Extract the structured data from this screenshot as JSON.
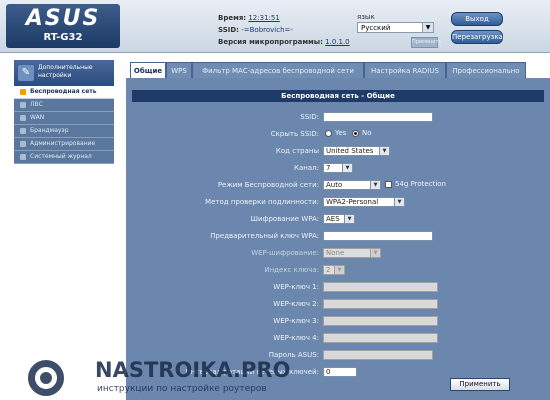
{
  "header": {
    "brand": "ASUS",
    "model": "RT-G32",
    "time_label": "Время:",
    "time_value": "12:31:51",
    "ssid_label": "SSID:",
    "ssid_value": "-=Bobrovich=-",
    "firmware_label": "Версия микропрограммы:",
    "firmware_value": "1.0.1.0",
    "lang_label": "язык",
    "lang_value": "Русский",
    "lang_apply": "Применить",
    "logout": "Выход",
    "reboot": "Перезагрузка"
  },
  "sidebar": {
    "heading": "Дополнительные настройки",
    "items": [
      {
        "label": "Беспроводная сеть",
        "active": true
      },
      {
        "label": "ЛВС",
        "active": false
      },
      {
        "label": "WAN",
        "active": false
      },
      {
        "label": "Брандмауэр",
        "active": false
      },
      {
        "label": "Администрирование",
        "active": false
      },
      {
        "label": "Системный журнал",
        "active": false
      }
    ]
  },
  "tabs": [
    {
      "label": "Общие",
      "active": true
    },
    {
      "label": "WPS",
      "active": false
    },
    {
      "label": "Фильтр MAC-адресов беспроводной сети",
      "active": false
    },
    {
      "label": "Настройка RADIUS",
      "active": false
    },
    {
      "label": "Профессионально",
      "active": false
    }
  ],
  "form": {
    "title": "Беспроводная сеть - Общие",
    "ssid_label": "SSID:",
    "ssid_value": "",
    "hide_ssid_label": "Скрыть SSID:",
    "yes": "Yes",
    "no": "No",
    "hide_ssid_selected": "No",
    "country_label": "Код страны",
    "country_value": "United States",
    "channel_label": "Канал:",
    "channel_value": "7",
    "mode_label": "Режим Беспроводной сети:",
    "mode_value": "Auto",
    "protection_label": "54g Protection",
    "protection_checked": false,
    "auth_label": "Метод проверки подлинности:",
    "auth_value": "WPA2-Personal",
    "wpa_enc_label": "Шифрование WPA:",
    "wpa_enc_value": "AES",
    "wpa_key_label": "Предварительный ключ WPA:",
    "wpa_key_value": "",
    "wep_enc_label": "WEP-шифрование:",
    "wep_enc_value": "None",
    "key_index_label": "Индекс ключа:",
    "key_index_value": "2",
    "wep_key1_label": "WEP-ключ 1:",
    "wep_key2_label": "WEP-ключ 2:",
    "wep_key3_label": "WEP-ключ 3:",
    "wep_key4_label": "WEP-ключ 4:",
    "asus_pass_label": "Пароль ASUS:",
    "rotation_label": "Интервал ротации сетевых ключей:",
    "rotation_value": "0",
    "apply": "Применить"
  },
  "watermark": {
    "brand": "NASTROIKA.PRO",
    "tagline": "инструкции по настройке роутеров"
  }
}
